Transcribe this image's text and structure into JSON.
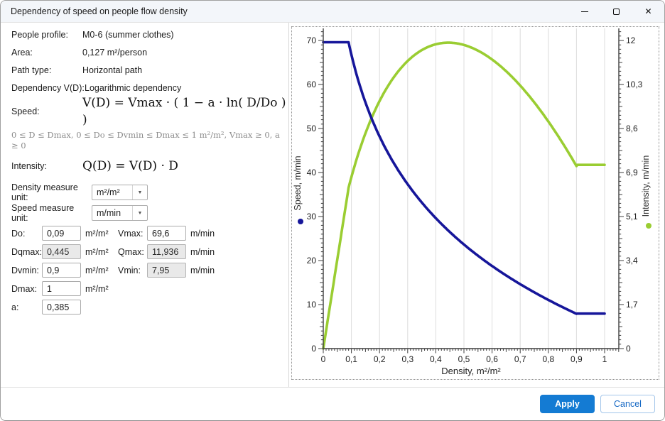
{
  "window": {
    "title": "Dependency of speed on people flow density"
  },
  "icons": {
    "dropdown": "▼",
    "close": "✕"
  },
  "colors": {
    "accent": "#147bd3",
    "speed_line": "#16169a",
    "intensity_line": "#9acd32",
    "readonly_bg": "#e9e9e9",
    "gridline": "#dcdcdc"
  },
  "profile": {
    "rows": [
      {
        "label": "People profile:",
        "value": "M0-6 (summer clothes)"
      },
      {
        "label": "Area:",
        "value": "0,127 m²/person"
      },
      {
        "label": "Path type:",
        "value": "Horizontal path"
      },
      {
        "label": "Dependency V(D):",
        "value": "Logarithmic dependency"
      }
    ]
  },
  "formulas": {
    "speed_label": "Speed:",
    "speed_formula": "V(D) = Vmax · ( 1 − a · ln( D/Do ) )",
    "constraints": "0 ≤ D ≤ Dmax, 0 ≤ Do ≤ Dvmin ≤ Dmax ≤ 1 m²/m², Vmax ≥ 0, a ≥ 0",
    "intensity_label": "Intensity:",
    "intensity_formula": "Q(D) = V(D) · D"
  },
  "units": {
    "density_label": "Density measure unit:",
    "density_value": "m²/m²",
    "speed_label": "Speed measure unit:",
    "speed_value": "m/min"
  },
  "params": {
    "rows": [
      {
        "label": "Do:",
        "value": "0,09",
        "unit": "m²/m²",
        "label2": "Vmax:",
        "value2": "69,6",
        "unit2": "m/min"
      },
      {
        "label": "Dqmax:",
        "value": "0,445",
        "unit": "m²/m²",
        "label2": "Qmax:",
        "value2": "11,936",
        "unit2": "m/min"
      },
      {
        "label": "Dvmin:",
        "value": "0,9",
        "unit": "m²/m²",
        "label2": "Vmin:",
        "value2": "7,95",
        "unit2": "m/min"
      },
      {
        "label": "Dmax:",
        "value": "1",
        "unit": "m²/m²"
      },
      {
        "label": "a:",
        "value": "0,385",
        "unit": ""
      }
    ]
  },
  "footer": {
    "apply_label": "Apply",
    "cancel_label": "Cancel"
  },
  "chart_data": {
    "type": "line",
    "title": "",
    "xlabel": "Density, m²/m²",
    "ylabel_left": "Speed, m/min",
    "ylabel_right": "Intensity, m/min",
    "xlim": [
      0,
      1.05
    ],
    "ylim_left": [
      0,
      72.7
    ],
    "ylim_right": [
      0,
      12.46
    ],
    "grid": "vertical",
    "legend_position": "axis-titles",
    "x_ticks": {
      "values": [
        0,
        0.1,
        0.2,
        0.3,
        0.4,
        0.5,
        0.6,
        0.7,
        0.8,
        0.9,
        1
      ],
      "labels": [
        "0",
        "0,1",
        "0,2",
        "0,3",
        "0,4",
        "0,5",
        "0,6",
        "0,7",
        "0,8",
        "0,9",
        "1"
      ]
    },
    "left_ticks": {
      "values": [
        0,
        10,
        20,
        30,
        40,
        50,
        60,
        70
      ],
      "labels": [
        "0",
        "10",
        "20",
        "30",
        "40",
        "50",
        "60",
        "70"
      ]
    },
    "right_ticks": {
      "values": [
        0,
        10,
        20,
        30,
        40,
        50,
        60,
        70
      ],
      "labels": [
        "0",
        "1,7",
        "3,4",
        "5,1",
        "6,9",
        "8,6",
        "10,3",
        "12"
      ]
    },
    "params": {
      "vmax": 69.6,
      "a": 0.385,
      "d0": 0.09,
      "dvmin": 0.9,
      "dmax": 1,
      "vmin": 7.95,
      "dqmax": 0.445,
      "qmax": 11.936
    },
    "series": [
      {
        "name": "Speed, m/min",
        "axis": "left",
        "color": "#16169a",
        "points": [
          [
            0,
            69.6
          ],
          [
            0.09,
            69.6
          ],
          [
            0.1,
            66.8
          ],
          [
            0.15,
            55.9
          ],
          [
            0.2,
            48.2
          ],
          [
            0.25,
            42.2
          ],
          [
            0.3,
            37.3
          ],
          [
            0.35,
            33.2
          ],
          [
            0.4,
            29.6
          ],
          [
            0.445,
            26.8
          ],
          [
            0.5,
            23.7
          ],
          [
            0.55,
            21.1
          ],
          [
            0.6,
            18.8
          ],
          [
            0.65,
            16.6
          ],
          [
            0.7,
            14.6
          ],
          [
            0.75,
            12.8
          ],
          [
            0.8,
            11.1
          ],
          [
            0.85,
            9.4
          ],
          [
            0.9,
            7.95
          ],
          [
            1,
            7.95
          ]
        ]
      },
      {
        "name": "Intensity, m/min",
        "axis": "right",
        "color": "#9acd32",
        "points": [
          [
            0,
            0
          ],
          [
            0.05,
            3.48
          ],
          [
            0.09,
            6.26
          ],
          [
            0.1,
            6.68
          ],
          [
            0.15,
            8.39
          ],
          [
            0.2,
            9.64
          ],
          [
            0.25,
            10.56
          ],
          [
            0.3,
            11.2
          ],
          [
            0.35,
            11.62
          ],
          [
            0.4,
            11.85
          ],
          [
            0.445,
            11.94
          ],
          [
            0.5,
            11.82
          ],
          [
            0.55,
            11.6
          ],
          [
            0.6,
            11.26
          ],
          [
            0.65,
            10.8
          ],
          [
            0.7,
            10.24
          ],
          [
            0.75,
            9.59
          ],
          [
            0.8,
            8.85
          ],
          [
            0.85,
            8.02
          ],
          [
            0.9,
            7.16
          ],
          [
            1,
            7.16
          ]
        ]
      }
    ]
  }
}
